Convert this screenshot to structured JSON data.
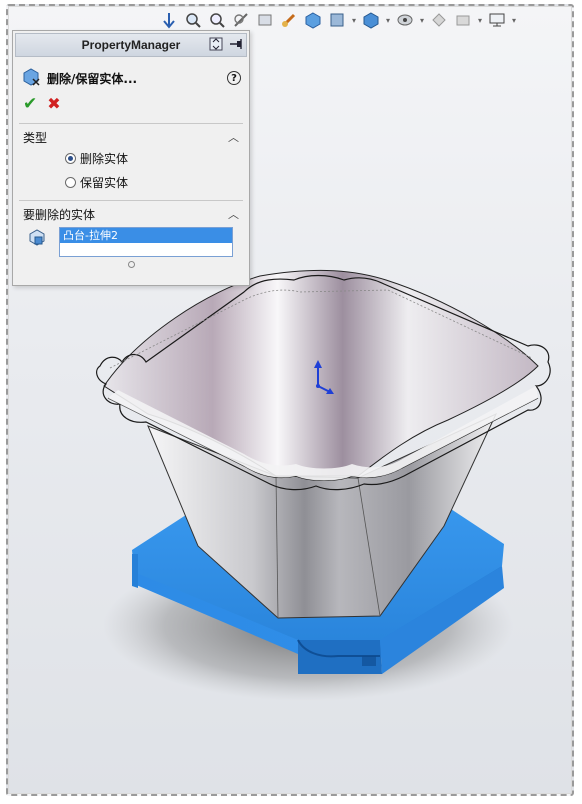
{
  "property_manager": {
    "title": "PropertyManager",
    "feature_name": "删除/保留实体...",
    "help_label": "?",
    "ok_icon": "checkmark",
    "cancel_icon": "close",
    "type_group": {
      "title": "类型",
      "options": [
        "删除实体",
        "保留实体"
      ],
      "selected": "删除实体"
    },
    "bodies_group": {
      "title": "要删除的实体",
      "items": [
        "凸台-拉伸2"
      ]
    }
  },
  "hud_toolbar": {
    "icons": [
      "zoom-to-fit-icon",
      "zoom-area-icon",
      "previous-view-icon",
      "section-view-icon",
      "dynamic-annotation-icon",
      "view-orientation-icon",
      "display-style-icon",
      "hide-show-icon",
      "edit-appearance-icon",
      "apply-scene-icon",
      "view-settings-icon"
    ]
  },
  "colors": {
    "selected_body": "#2e8de8",
    "pot_surface": "#dcdde0",
    "accent_highlight": "#3a8ee6"
  }
}
